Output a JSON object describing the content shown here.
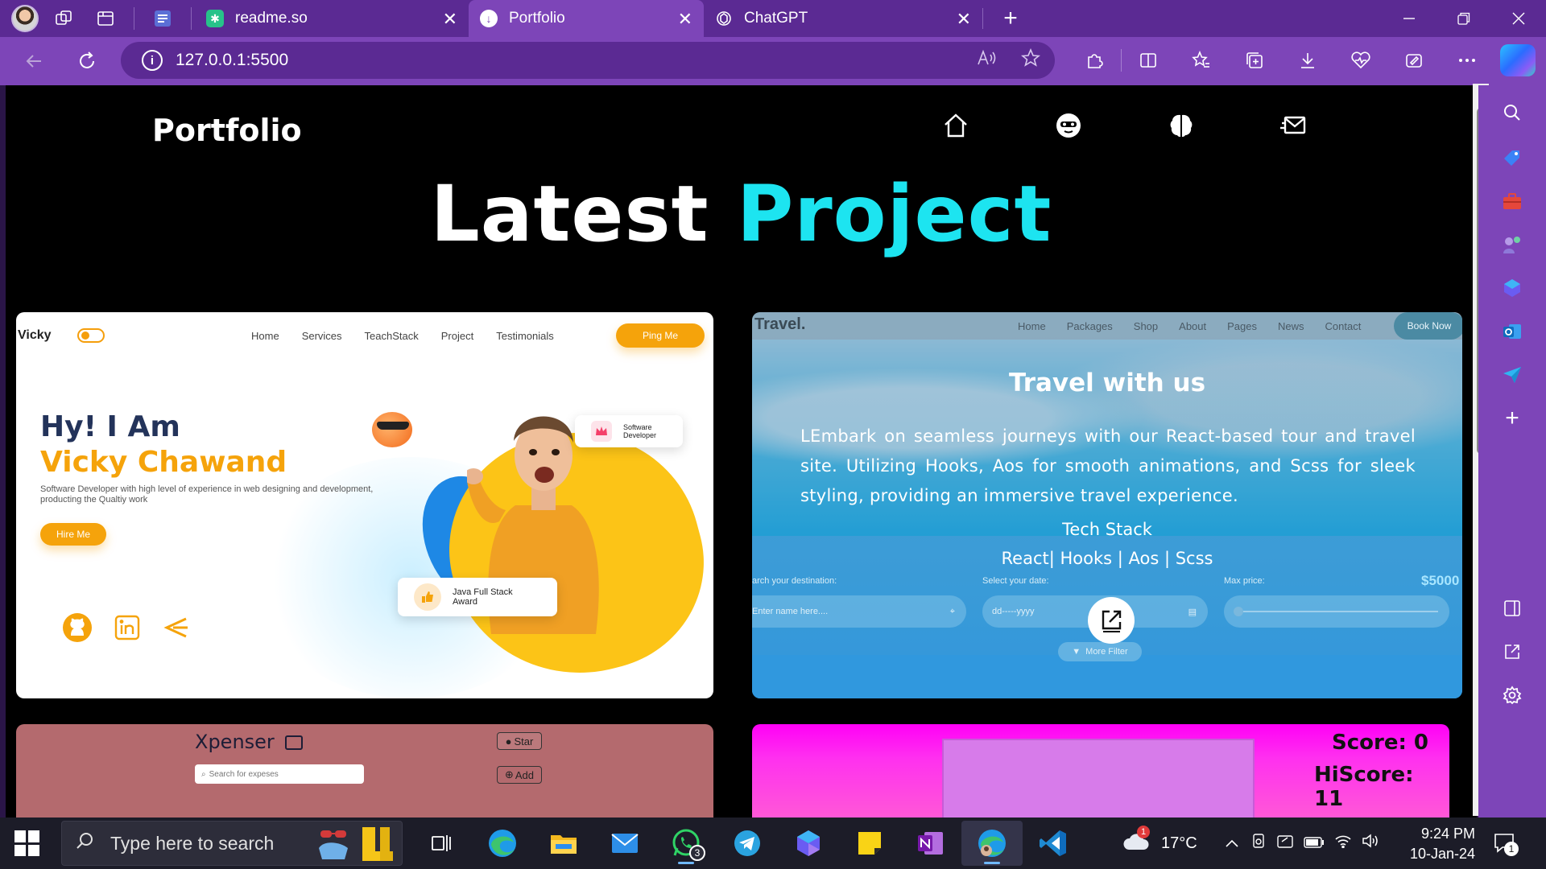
{
  "browser": {
    "tabs": [
      {
        "title": "readme.so",
        "favicon_color": "#27c28a"
      },
      {
        "title": "Portfolio",
        "favicon_color": "#ffffff",
        "active": true
      },
      {
        "title": "ChatGPT",
        "favicon_color": "#ffffff"
      }
    ],
    "url": "127.0.0.1:5500",
    "accent": "#7d45b8",
    "tabbar_color": "#5b2a93"
  },
  "page": {
    "logo": "Portfolio",
    "nav_icons": [
      "home-icon",
      "face-icon",
      "brain-icon",
      "mail-icon"
    ],
    "heading_main": "Latest",
    "heading_accent": "Project",
    "accent_color": "#1de4f0"
  },
  "card1": {
    "brand": "Vicky",
    "menu": [
      "Home",
      "Services",
      "TeachStack",
      "Project",
      "Testimonials"
    ],
    "cta": "Ping Me",
    "greeting": "Hy! I Am",
    "name": "Vicky Chawand",
    "description": "Software Developer with high level of experience in web designing and development, producting the Qualtiy work",
    "hire": "Hire Me",
    "badge1": "Software Developer",
    "badge2": "Java Full Stack Award",
    "social_icons": [
      "github-icon",
      "linkedin-icon",
      "codechef-icon"
    ],
    "brand_color": "#f5a30b"
  },
  "card2": {
    "logo": "Travel.",
    "menu": [
      "Home",
      "Packages",
      "Shop",
      "About",
      "Pages",
      "News",
      "Contact"
    ],
    "cta": "Book Now",
    "title": "Travel with us",
    "description": "LEmbark on seamless journeys with our React-based tour and travel site. Utilizing Hooks, Aos for smooth animations, and Scss for sleek styling, providing an immersive travel experience.",
    "stack_heading": "Tech Stack",
    "stack": "React| Hooks | Aos | Scss",
    "filter_labels": [
      "arch your destination:",
      "Select your date:",
      "Max price:"
    ],
    "destination_placeholder": "Enter name here....",
    "date_placeholder": "dd-----yyyy",
    "max_price": "$5000",
    "more_filter": "More Filter"
  },
  "card3": {
    "title": "Xpenser",
    "star": "Star",
    "search_placeholder": "Search for expeses",
    "add": "Add",
    "bg_color": "#b46a6e"
  },
  "card4": {
    "score": "Score: 0",
    "hiscore": "HiScore: 11",
    "bg_color": "#ff00f6"
  },
  "taskbar": {
    "search_placeholder": "Type here to search",
    "weather": "17°C",
    "weather_badge": "1",
    "time": "9:24 PM",
    "date": "10-Jan-24",
    "whatsapp_badge": "3",
    "notif_count": "1",
    "apps": [
      "task-view-icon",
      "edge-icon",
      "file-explorer-icon",
      "mail-icon",
      "whatsapp-icon",
      "telegram-icon",
      "copilot-icon",
      "sticky-notes-icon",
      "onenote-icon",
      "edge-profile-icon",
      "vscode-icon"
    ]
  }
}
